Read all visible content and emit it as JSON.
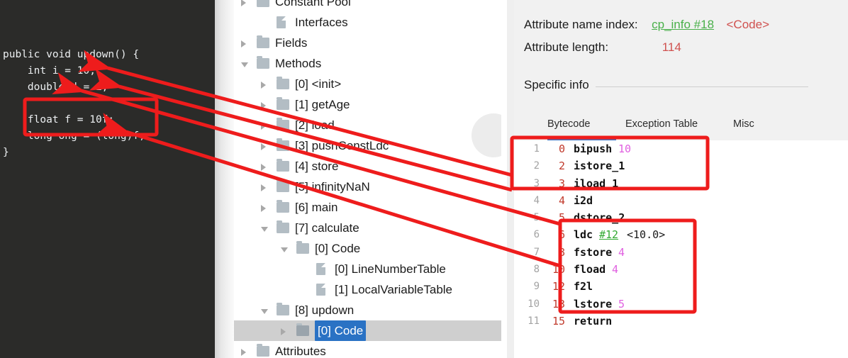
{
  "code_panel": {
    "name": "java-source-snippet",
    "lines": [
      "public void updown() {",
      "    int i = 10;",
      "    double d = i;",
      "",
      "    float f = 10f;",
      "    long ong = (long)f;",
      "}"
    ],
    "highlight_box_label": "source-highlight-float-long"
  },
  "tree": {
    "rows": [
      {
        "label": "Constant Pool",
        "indent": 0,
        "icon": "folder-icon",
        "twisty": "collapsed",
        "selected": false,
        "clipped": true
      },
      {
        "label": "Interfaces",
        "indent": 1,
        "icon": "file-icon",
        "twisty": "none",
        "selected": false
      },
      {
        "label": "Fields",
        "indent": 0,
        "icon": "folder-icon",
        "twisty": "collapsed",
        "selected": false
      },
      {
        "label": "Methods",
        "indent": 0,
        "icon": "folder-icon",
        "twisty": "expanded",
        "selected": false
      },
      {
        "label": "[0] <init>",
        "indent": 1,
        "icon": "folder-icon",
        "twisty": "collapsed",
        "selected": false
      },
      {
        "label": "[1] getAge",
        "indent": 1,
        "icon": "folder-icon",
        "twisty": "collapsed",
        "selected": false
      },
      {
        "label": "[2] load",
        "indent": 1,
        "icon": "folder-icon",
        "twisty": "collapsed",
        "selected": false
      },
      {
        "label": "[3] pushConstLdc",
        "indent": 1,
        "icon": "folder-icon",
        "twisty": "collapsed",
        "selected": false
      },
      {
        "label": "[4] store",
        "indent": 1,
        "icon": "folder-icon",
        "twisty": "collapsed",
        "selected": false
      },
      {
        "label": "[5] infinityNaN",
        "indent": 1,
        "icon": "folder-icon",
        "twisty": "collapsed",
        "selected": false
      },
      {
        "label": "[6] main",
        "indent": 1,
        "icon": "folder-icon",
        "twisty": "collapsed",
        "selected": false
      },
      {
        "label": "[7] calculate",
        "indent": 1,
        "icon": "folder-icon",
        "twisty": "expanded",
        "selected": false
      },
      {
        "label": "[0] Code",
        "indent": 2,
        "icon": "folder-icon",
        "twisty": "expanded",
        "selected": false
      },
      {
        "label": "[0] LineNumberTable",
        "indent": 3,
        "icon": "file-icon",
        "twisty": "none",
        "selected": false
      },
      {
        "label": "[1] LocalVariableTable",
        "indent": 3,
        "icon": "file-icon",
        "twisty": "none",
        "selected": false
      },
      {
        "label": "[8] updown",
        "indent": 1,
        "icon": "folder-icon",
        "twisty": "expanded",
        "selected": false
      },
      {
        "label": "[0] Code",
        "indent": 2,
        "icon": "folder-icon",
        "twisty": "collapsed",
        "selected": true
      },
      {
        "label": "Attributes",
        "indent": 0,
        "icon": "folder-icon",
        "twisty": "collapsed",
        "selected": false
      }
    ]
  },
  "detail": {
    "attribute_name_index_label": "Attribute name index:",
    "attribute_name_index_link": "cp_info #18",
    "attribute_name_index_value": "<Code>",
    "attribute_length_label": "Attribute length:",
    "attribute_length_value": "114",
    "specific_info_label": "Specific info",
    "tabs": [
      {
        "label": "Bytecode",
        "active": true
      },
      {
        "label": "Exception Table",
        "active": false
      },
      {
        "label": "Misc",
        "active": false
      }
    ]
  },
  "bytecode": {
    "rows": [
      {
        "line": "1",
        "offset": "0",
        "mnemonic": "bipush",
        "arg": "10",
        "cp": "",
        "comment": ""
      },
      {
        "line": "2",
        "offset": "2",
        "mnemonic": "istore_1",
        "arg": "",
        "cp": "",
        "comment": ""
      },
      {
        "line": "3",
        "offset": "3",
        "mnemonic": "iload_1",
        "arg": "",
        "cp": "",
        "comment": ""
      },
      {
        "line": "4",
        "offset": "4",
        "mnemonic": "i2d",
        "arg": "",
        "cp": "",
        "comment": ""
      },
      {
        "line": "5",
        "offset": "5",
        "mnemonic": "dstore_2",
        "arg": "",
        "cp": "",
        "comment": ""
      },
      {
        "line": "6",
        "offset": "6",
        "mnemonic": "ldc",
        "arg": "",
        "cp": "#12",
        "comment": "<10.0>"
      },
      {
        "line": "7",
        "offset": "8",
        "mnemonic": "fstore",
        "arg": "4",
        "cp": "",
        "comment": ""
      },
      {
        "line": "8",
        "offset": "10",
        "mnemonic": "fload",
        "arg": "4",
        "cp": "",
        "comment": ""
      },
      {
        "line": "9",
        "offset": "12",
        "mnemonic": "f2l",
        "arg": "",
        "cp": "",
        "comment": ""
      },
      {
        "line": "10",
        "offset": "13",
        "mnemonic": "lstore",
        "arg": "5",
        "cp": "",
        "comment": ""
      },
      {
        "line": "11",
        "offset": "15",
        "mnemonic": "return",
        "arg": "",
        "cp": "",
        "comment": ""
      }
    ]
  },
  "annotations": {
    "color": "#ee1c1c",
    "boxes": [
      {
        "name": "source-code-highlight-box"
      },
      {
        "name": "bytecode-highlight-box-int-double"
      },
      {
        "name": "bytecode-highlight-box-float-long"
      }
    ],
    "arrows": [
      {
        "name": "arrow-bipush-to-int-i"
      },
      {
        "name": "arrow-istore-to-double-d"
      },
      {
        "name": "arrow-i2d-to-double-d"
      },
      {
        "name": "arrow-float-block-to-source-box"
      }
    ]
  },
  "colors": {
    "annotation_red": "#ee1c1c",
    "selection_blue": "#2a72c4",
    "tab_underline_blue": "#3f72c2",
    "cp_link_green": "#49b04a",
    "value_red": "#d0514f",
    "arg_magenta": "#e060e0",
    "offset_red": "#c0392b",
    "code_bg": "#2b2b29"
  }
}
